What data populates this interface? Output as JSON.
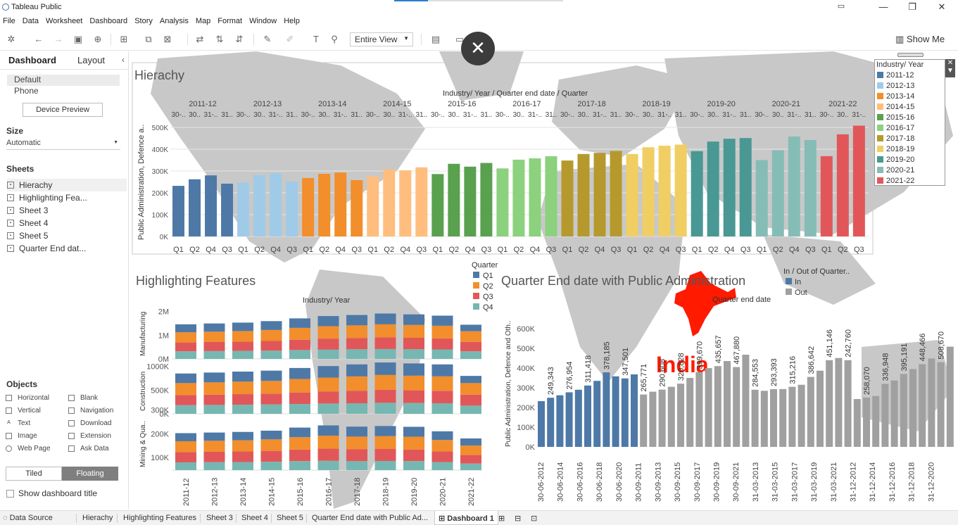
{
  "window": {
    "app_title": "Tableau Public",
    "minimize": "—",
    "restore": "❐",
    "close": "✕",
    "progress": 0.2
  },
  "menu": [
    "File",
    "Data",
    "Worksheet",
    "Dashboard",
    "Story",
    "Analysis",
    "Map",
    "Format",
    "Window",
    "Help"
  ],
  "toolbar": {
    "view_label": "Entire View",
    "show_me_label": "Show Me"
  },
  "overlay": {
    "close_label": "✕"
  },
  "sidebar": {
    "tabs": [
      "Dashboard",
      "Layout"
    ],
    "collapse": "‹",
    "devices": [
      "Default",
      "Phone"
    ],
    "device_preview": "Device Preview",
    "size_heading": "Size",
    "size_value": "Automatic",
    "sheets_heading": "Sheets",
    "sheets": [
      "Hierachy",
      "Highlighting Fea...",
      "Sheet 3",
      "Sheet 4",
      "Sheet 5",
      "Quarter End dat..."
    ],
    "objects_heading": "Objects",
    "objects": [
      "Horizontal",
      "Blank",
      "Vertical",
      "Navigation",
      "Text",
      "Download",
      "Image",
      "Extension",
      "Web Page",
      "Ask Data"
    ],
    "tiled": "Tiled",
    "floating": "Floating",
    "show_title": "Show dashboard title"
  },
  "status_tabs": [
    "Data Source",
    "Hierachy",
    "Highlighting Features",
    "Sheet 3",
    "Sheet 4",
    "Sheet 5",
    "Quarter End date with Public Ad...",
    "Dashboard 1"
  ],
  "colors": {
    "2011-12": "#4e79a7",
    "2012-13": "#a0cbe8",
    "2013-14": "#f28e2b",
    "2014-15": "#ffbe7d",
    "2015-16": "#59a14f",
    "2016-17": "#8cd17d",
    "2017-18": "#b6992d",
    "2018-19": "#f1ce63",
    "2019-20": "#499894",
    "2020-21": "#86bcb6",
    "2021-22": "#e15759",
    "q1": "#4e79a7",
    "q2": "#f28e2b",
    "q3": "#e15759",
    "q4": "#76b7b2",
    "in": "#4e79a7",
    "out": "#a0a0a0",
    "india": "#ff1a00",
    "map": "#c8c8c8"
  },
  "legend": {
    "title": "Industry/ Year",
    "items": [
      "2011-12",
      "2012-13",
      "2013-14",
      "2014-15",
      "2015-16",
      "2016-17",
      "2017-18",
      "2018-19",
      "2019-20",
      "2020-21",
      "2021-22"
    ]
  },
  "map_label": "India",
  "chart_data": [
    {
      "type": "bar",
      "title": "Hierachy",
      "header": "Industry/ Year / Quarter end date / Quarter",
      "ylabel": "Public Administration, Defence a..",
      "ylim": [
        0,
        500000
      ],
      "yticks": [
        "0K",
        "100K",
        "200K",
        "300K",
        "400K",
        "500K"
      ],
      "groups": [
        {
          "year": "2011-12",
          "dates": [
            "30-..",
            "30..",
            "31-..",
            "31.."
          ],
          "quarters": [
            "Q1",
            "Q2",
            "Q4",
            "Q3"
          ],
          "values": [
            232000,
            262000,
            280000,
            242000
          ]
        },
        {
          "year": "2012-13",
          "dates": [
            "30-..",
            "30..",
            "31-..",
            "31.."
          ],
          "quarters": [
            "Q1",
            "Q2",
            "Q4",
            "Q3"
          ],
          "values": [
            247000,
            281000,
            290000,
            252000
          ]
        },
        {
          "year": "2013-14",
          "dates": [
            "30-..",
            "30..",
            "31-..",
            "31.."
          ],
          "quarters": [
            "Q1",
            "Q2",
            "Q4",
            "Q3"
          ],
          "values": [
            268000,
            287000,
            293000,
            258000
          ]
        },
        {
          "year": "2014-15",
          "dates": [
            "30-..",
            "30..",
            "31-..",
            "31.."
          ],
          "quarters": [
            "Q1",
            "Q2",
            "Q4",
            "Q3"
          ],
          "values": [
            275000,
            307000,
            303000,
            317000
          ]
        },
        {
          "year": "2015-16",
          "dates": [
            "30-..",
            "30..",
            "31-..",
            "31.."
          ],
          "quarters": [
            "Q1",
            "Q2",
            "Q4",
            "Q3"
          ],
          "values": [
            286000,
            333000,
            320000,
            337000
          ]
        },
        {
          "year": "2016-17",
          "dates": [
            "30-..",
            "30..",
            "31-..",
            "31.."
          ],
          "quarters": [
            "Q1",
            "Q2",
            "Q4",
            "Q3"
          ],
          "values": [
            312000,
            352000,
            358000,
            368000
          ]
        },
        {
          "year": "2017-18",
          "dates": [
            "30-..",
            "30..",
            "31-..",
            "31.."
          ],
          "quarters": [
            "Q1",
            "Q2",
            "Q4",
            "Q3"
          ],
          "values": [
            348000,
            378000,
            383000,
            392000
          ]
        },
        {
          "year": "2018-19",
          "dates": [
            "30-..",
            "30..",
            "31-..",
            "31.."
          ],
          "quarters": [
            "Q1",
            "Q2",
            "Q4",
            "Q3"
          ],
          "values": [
            378000,
            409000,
            416000,
            421000
          ]
        },
        {
          "year": "2019-20",
          "dates": [
            "30-..",
            "30..",
            "31-..",
            "31.."
          ],
          "quarters": [
            "Q1",
            "Q2",
            "Q4",
            "Q3"
          ],
          "values": [
            391000,
            435000,
            448000,
            451000
          ]
        },
        {
          "year": "2020-21",
          "dates": [
            "30-..",
            "30..",
            "31-..",
            "31.."
          ],
          "quarters": [
            "Q1",
            "Q2",
            "Q4",
            "Q3"
          ],
          "values": [
            350000,
            395000,
            458000,
            442000
          ]
        },
        {
          "year": "2021-22",
          "dates": [
            "30-..",
            "30..",
            "31-.."
          ],
          "quarters": [
            "Q1",
            "Q2",
            "Q3"
          ],
          "values": [
            368000,
            468000,
            508000
          ]
        }
      ]
    },
    {
      "type": "bar",
      "title": "Highlighting Features",
      "header": "Industry/ Year",
      "stacked": true,
      "legend_title": "Quarter",
      "quarters": [
        "Q1",
        "Q2",
        "Q3",
        "Q4"
      ],
      "categories": [
        "2011-12",
        "2012-13",
        "2013-14",
        "2014-15",
        "2015-16",
        "2016-17",
        "2017-18",
        "2018-19",
        "2019-20",
        "2020-21",
        "2021-22"
      ],
      "panels": [
        {
          "label": "Manufacturing",
          "yticks": [
            "0M",
            "1M",
            "2M"
          ],
          "ymax": 2500000,
          "values": [
            [
              380000,
              480000,
              420000,
              360000
            ],
            [
              390000,
              490000,
              430000,
              370000
            ],
            [
              400000,
              500000,
              440000,
              380000
            ],
            [
              420000,
              520000,
              460000,
              390000
            ],
            [
              450000,
              560000,
              490000,
              420000
            ],
            [
              480000,
              590000,
              520000,
              440000
            ],
            [
              490000,
              600000,
              530000,
              460000
            ],
            [
              510000,
              620000,
              550000,
              470000
            ],
            [
              500000,
              610000,
              540000,
              460000
            ],
            [
              480000,
              600000,
              520000,
              450000
            ],
            [
              310000,
              500000,
              450000,
              360000
            ]
          ]
        },
        {
          "label": "Construction",
          "yticks": [
            "0K",
            "500K",
            "1000K"
          ],
          "ymax": 1100000,
          "values": [
            [
              200000,
              250000,
              210000,
              180000
            ],
            [
              205000,
              255000,
              215000,
              185000
            ],
            [
              210000,
              260000,
              220000,
              190000
            ],
            [
              215000,
              265000,
              225000,
              195000
            ],
            [
              230000,
              280000,
              240000,
              205000
            ],
            [
              240000,
              290000,
              250000,
              215000
            ],
            [
              250000,
              300000,
              260000,
              220000
            ],
            [
              260000,
              310000,
              270000,
              230000
            ],
            [
              255000,
              305000,
              265000,
              225000
            ],
            [
              250000,
              300000,
              260000,
              220000
            ],
            [
              150000,
              240000,
              230000,
              170000
            ]
          ]
        },
        {
          "label": "Mining & Qua..",
          "yticks": [
            "100K",
            "200K",
            "300K"
          ],
          "ymax": 340000,
          "values": [
            [
              52000,
              70000,
              66000,
              50000
            ],
            [
              53000,
              71000,
              67000,
              51000
            ],
            [
              54000,
              72000,
              68000,
              52000
            ],
            [
              56000,
              74000,
              70000,
              54000
            ],
            [
              62000,
              80000,
              74000,
              58000
            ],
            [
              66000,
              84000,
              78000,
              60000
            ],
            [
              64000,
              82000,
              76000,
              58000
            ],
            [
              65000,
              83000,
              77000,
              59000
            ],
            [
              64000,
              82000,
              75000,
              58000
            ],
            [
              56000,
              74000,
              68000,
              52000
            ],
            [
              46000,
              60000,
              56000,
              42000
            ]
          ]
        }
      ]
    },
    {
      "type": "bar",
      "title": "Quarter End date with Public Administration",
      "header": "Quarter end date",
      "ylabel": "Public Administration, Defence and Oth..",
      "legend_title": "In / Out of Quarter..",
      "legend_items": [
        "In",
        "Out"
      ],
      "ylim": [
        0,
        650000
      ],
      "yticks": [
        "0K",
        "100K",
        "200K",
        "300K",
        "400K",
        "500K",
        "600K"
      ],
      "xticks": [
        "30-06-2012",
        "30-06-2014",
        "30-06-2016",
        "30-06-2018",
        "30-06-2020",
        "30-09-2011",
        "30-09-2013",
        "30-09-2015",
        "30-09-2017",
        "30-09-2019",
        "30-09-2021",
        "31-03-2013",
        "31-03-2015",
        "31-03-2017",
        "31-03-2019",
        "31-03-2021",
        "31-12-2012",
        "31-12-2014",
        "31-12-2016",
        "31-12-2018",
        "31-12-2020"
      ],
      "values": [
        232000,
        249343,
        262000,
        276954,
        290000,
        311418,
        335000,
        378185,
        358000,
        347501,
        368000,
        265771,
        280000,
        290608,
        305000,
        320828,
        350000,
        380000,
        399670,
        410000,
        435657,
        405000,
        467880,
        290000,
        284553,
        293000,
        293393,
        305000,
        315216,
        355000,
        386642,
        440000,
        451146,
        440000,
        242760,
        250000,
        258070,
        320000,
        336948,
        370000,
        395191,
        420000,
        448466,
        430000,
        508670
      ],
      "in_count": 11,
      "labels": [
        "249,343",
        "276,954",
        "311,418",
        "378,185",
        "347,501",
        "265,771",
        "290,608",
        "320,828",
        "399,670",
        "435,657",
        "467,880",
        "284,553",
        "293,393",
        "315,216",
        "386,642",
        "451,146",
        "242,760",
        "258,070",
        "336,948",
        "395,191",
        "448,466",
        "508,670"
      ]
    }
  ]
}
